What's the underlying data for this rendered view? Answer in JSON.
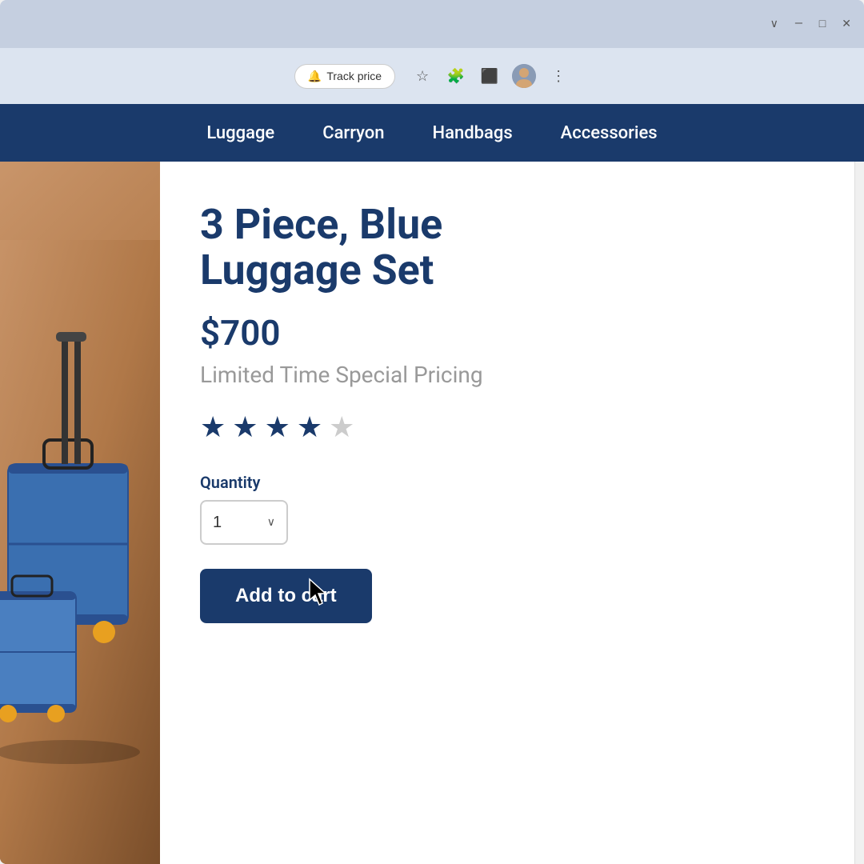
{
  "browser": {
    "window_controls": [
      "∨",
      "—",
      "□",
      "✕"
    ],
    "track_price_label": "Track price",
    "track_price_icon": "🔔"
  },
  "nav": {
    "items": [
      "Luggage",
      "Carryon",
      "Handbags",
      "Accessories"
    ]
  },
  "product": {
    "title_line1": "3 Piece, Blue",
    "title_line2": "Luggage Set",
    "price": "$700",
    "special_pricing": "Limited Time Special Pricing",
    "stars_filled": 4,
    "stars_empty": 1,
    "quantity_label": "Quantity",
    "quantity_value": "1",
    "add_to_cart_label": "Add to cart"
  }
}
